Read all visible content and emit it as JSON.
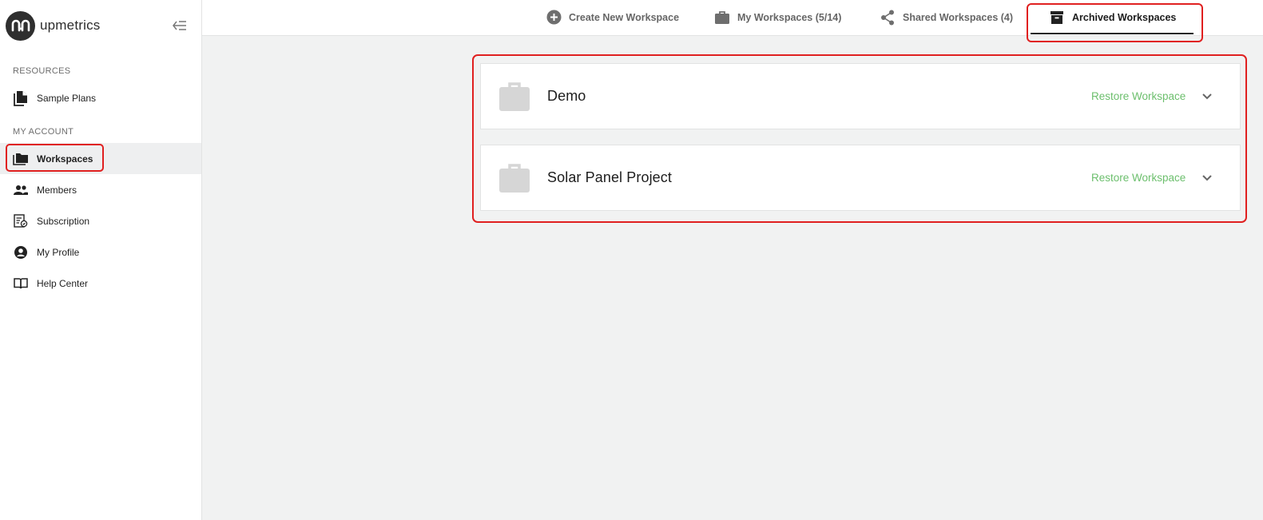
{
  "brand": {
    "name": "upmetrics"
  },
  "sidebar": {
    "sections": [
      {
        "label": "RESOURCES"
      },
      {
        "label": "MY ACCOUNT"
      }
    ],
    "items": [
      {
        "label": "Sample Plans",
        "icon": "documents-icon"
      },
      {
        "label": "Workspaces",
        "icon": "folder-icon",
        "active": true
      },
      {
        "label": "Members",
        "icon": "people-icon"
      },
      {
        "label": "Subscription",
        "icon": "receipt-icon"
      },
      {
        "label": "My Profile",
        "icon": "account-circle-icon"
      },
      {
        "label": "Help Center",
        "icon": "book-icon"
      }
    ]
  },
  "tabs": [
    {
      "label": "Create New Workspace",
      "icon": "plus-circle-icon"
    },
    {
      "label": "My Workspaces (5/14)",
      "icon": "briefcase-icon"
    },
    {
      "label": "Shared Workspaces (4)",
      "icon": "share-icon"
    },
    {
      "label": "Archived Workspaces",
      "icon": "archive-icon",
      "active": true
    }
  ],
  "workspaces": [
    {
      "name": "Demo",
      "action": "Restore Workspace"
    },
    {
      "name": "Solar Panel Project",
      "action": "Restore Workspace"
    }
  ],
  "colors": {
    "accent_green": "#6cbf6d",
    "highlight_red": "#e02020",
    "background": "#f1f2f2"
  }
}
